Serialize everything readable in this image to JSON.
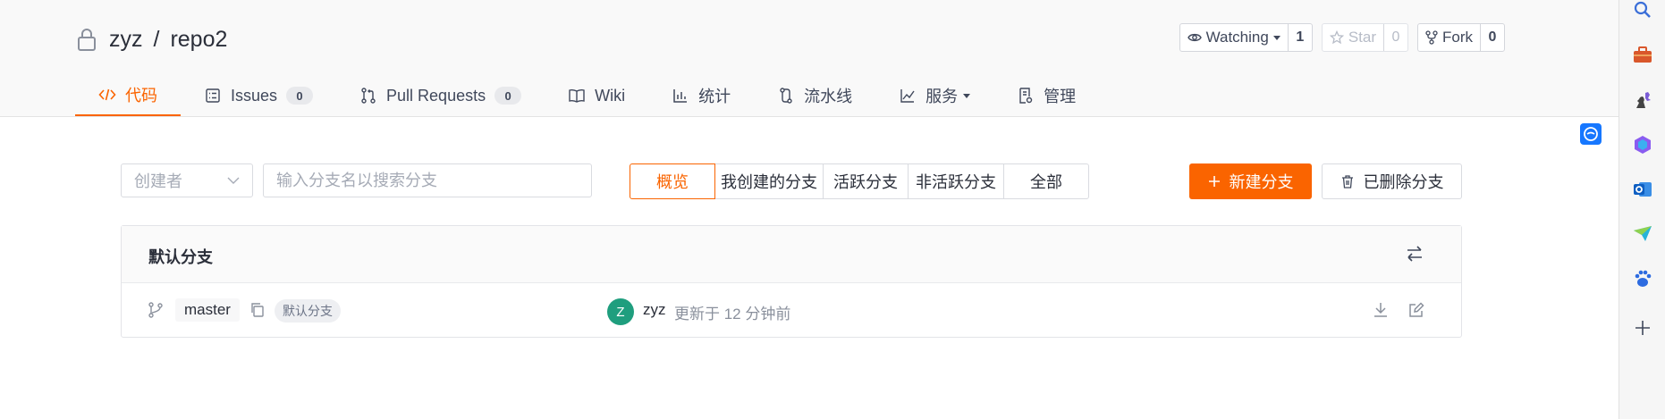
{
  "repo": {
    "owner": "zyz",
    "separator": "/",
    "name": "repo2"
  },
  "actions": {
    "watch": {
      "label": "Watching",
      "count": "1"
    },
    "star": {
      "label": "Star",
      "count": "0"
    },
    "fork": {
      "label": "Fork",
      "count": "0"
    }
  },
  "tabs": [
    {
      "label": "代码",
      "icon": "code-icon",
      "active": true
    },
    {
      "label": "Issues",
      "count": "0",
      "icon": "issues-icon"
    },
    {
      "label": "Pull Requests",
      "count": "0",
      "icon": "pull-request-icon"
    },
    {
      "label": "Wiki",
      "icon": "book-icon"
    },
    {
      "label": "统计",
      "icon": "bar-chart-icon"
    },
    {
      "label": "流水线",
      "icon": "pipeline-icon"
    },
    {
      "label": "服务",
      "icon": "line-chart-icon",
      "dropdown": true
    },
    {
      "label": "管理",
      "icon": "settings-doc-icon"
    }
  ],
  "filters": {
    "creator_placeholder": "创建者",
    "search_placeholder": "输入分支名以搜索分支",
    "segments": [
      "概览",
      "我创建的分支",
      "活跃分支",
      "非活跃分支",
      "全部"
    ],
    "active_segment": "概览",
    "new_branch": "新建分支",
    "deleted_branch": "已删除分支"
  },
  "default_branch_panel": {
    "title": "默认分支",
    "branch": {
      "name": "master",
      "badge": "默认分支",
      "avatar_letter": "Z",
      "committer": "zyz",
      "updated": "更新于 12 分钟前"
    }
  },
  "colors": {
    "accent": "#fa6400",
    "avatar": "#1f9e7e"
  }
}
